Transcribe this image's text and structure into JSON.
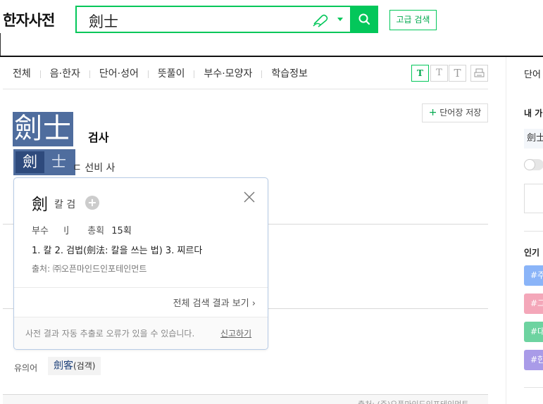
{
  "header": {
    "logo": "한자사전",
    "search": {
      "value": "劍士"
    },
    "advanced_search": "고급 검색"
  },
  "tabs": [
    "전체",
    "음·한자",
    "단어·성어",
    "뜻풀이",
    "부수·모양자",
    "학습정보"
  ],
  "font_buttons": [
    "T",
    "T",
    "T"
  ],
  "entry": {
    "save_label": "단어장 저장",
    "headword": "劍士",
    "reading": "검사",
    "chars": [
      "劍",
      "士"
    ],
    "meaning_visible": "ㄷ 선비 사",
    "synonym_label": "유의어",
    "synonym_hanja": "劍客",
    "synonym_reading": "(검객)",
    "bottom_text": "출처: (주)오픈마인드인포테인먼트"
  },
  "popup": {
    "char": "劍",
    "meaning": "칼 검",
    "radical_label": "부수",
    "radical": "刂",
    "strokes_label": "총획",
    "strokes": "15획",
    "definition": "1. 칼 2. 검법(劍法: 칼을 쓰는 법) 3. 찌르다",
    "source": "출처: ㈜오픈마인드인포테인먼트",
    "all_results": "전체 검색 결과 보기",
    "note": "사전 결과 자동 추출로 오류가 있을 수 있습니다.",
    "report": "신고하기"
  },
  "right_column": {
    "title": "단어",
    "subtitle": "내 가",
    "chip": "劍士",
    "popular": "인기",
    "tags": [
      {
        "label": "#주",
        "color": "#8ab4f8"
      },
      {
        "label": "#그",
        "color": "#f4a7b9"
      },
      {
        "label": "#대",
        "color": "#6dd3a0"
      },
      {
        "label": "#한",
        "color": "#a99be8"
      }
    ]
  },
  "colors": {
    "accent": "#03c75a",
    "highlight": "#4f6d9e"
  }
}
